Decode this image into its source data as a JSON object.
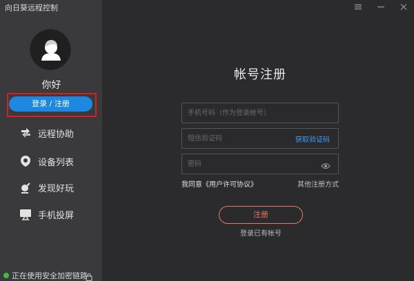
{
  "app": {
    "title": "向日葵远程控制"
  },
  "sidebar": {
    "greeting": "你好",
    "login_button": "登录 / 注册",
    "items": [
      {
        "label": "远程协助",
        "icon": "remote-assist-icon"
      },
      {
        "label": "设备列表",
        "icon": "device-list-icon"
      },
      {
        "label": "发现好玩",
        "icon": "discover-icon"
      },
      {
        "label": "手机投屏",
        "icon": "screen-cast-icon"
      }
    ],
    "status_text": "正在使用安全加密链路"
  },
  "window_controls": [
    "menu-icon",
    "minimize-icon",
    "close-icon"
  ],
  "form": {
    "title": "帐号注册",
    "phone_placeholder": "手机号码（作为登录帐号）",
    "code_placeholder": "短信验证码",
    "get_code_label": "获取验证码",
    "password_placeholder": "密码",
    "agree_text": "我同意《用户许可协议》",
    "other_methods": "其他注册方式",
    "register_button": "注册",
    "have_account": "登录已有帐号"
  },
  "colors": {
    "accent_blue": "#1e87e0",
    "link_blue": "#3f9ef4",
    "register_coral": "#e87a68",
    "highlight_red": "#d42222",
    "status_green": "#3dbb43"
  }
}
